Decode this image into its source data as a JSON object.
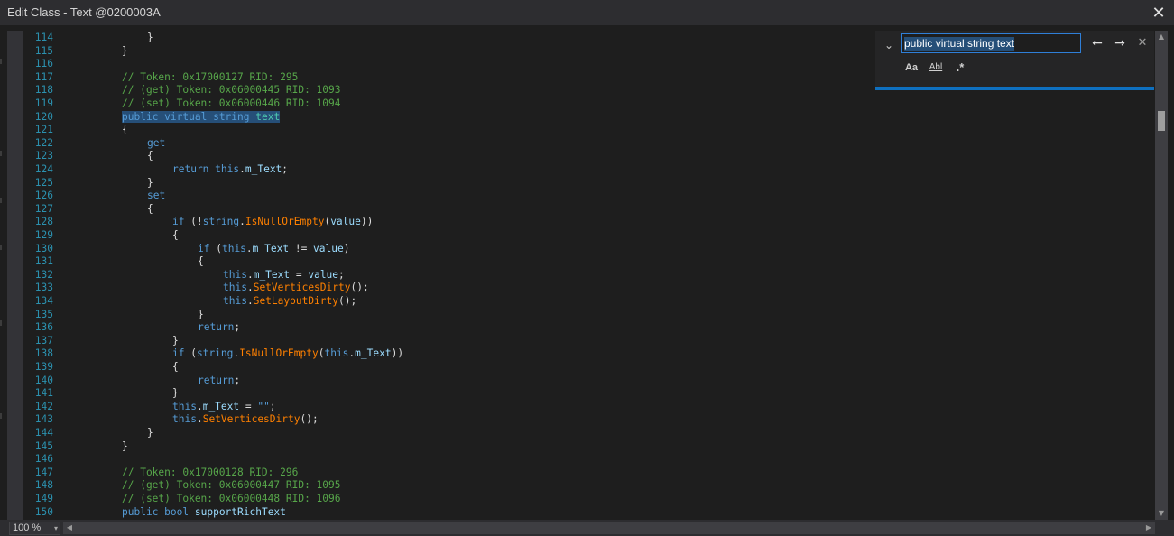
{
  "window": {
    "title": "Edit Class - Text @0200003A",
    "close_glyph": "✕"
  },
  "find": {
    "query": "public virtual string text",
    "chevron_glyph": "⌄",
    "prev_glyph": "←",
    "next_glyph": "→",
    "close_glyph": "✕",
    "options": {
      "match_case": "Aa",
      "whole_word": "Abl",
      "regex": ".*"
    }
  },
  "status": {
    "zoom": "100 %",
    "zoom_caret": "▾"
  },
  "scroll": {
    "up": "▲",
    "down": "▼",
    "left": "◀",
    "right": "▶"
  },
  "code": {
    "lines": [
      {
        "n": "114",
        "t": "    }"
      },
      {
        "n": "115",
        "t": "}"
      },
      {
        "n": "116",
        "t": ""
      },
      {
        "n": "117",
        "t": "// Token: 0x17000127 RID: 295"
      },
      {
        "n": "118",
        "t": "// (get) Token: 0x06000445 RID: 1093"
      },
      {
        "n": "119",
        "t": "// (set) Token: 0x06000446 RID: 1094"
      },
      {
        "n": "120",
        "t": "public virtual string text"
      },
      {
        "n": "121",
        "t": "{"
      },
      {
        "n": "122",
        "t": "    get"
      },
      {
        "n": "123",
        "t": "    {"
      },
      {
        "n": "124",
        "t": "        return this.m_Text;"
      },
      {
        "n": "125",
        "t": "    }"
      },
      {
        "n": "126",
        "t": "    set"
      },
      {
        "n": "127",
        "t": "    {"
      },
      {
        "n": "128",
        "t": "        if (!string.IsNullOrEmpty(value))"
      },
      {
        "n": "129",
        "t": "        {"
      },
      {
        "n": "130",
        "t": "            if (this.m_Text != value)"
      },
      {
        "n": "131",
        "t": "            {"
      },
      {
        "n": "132",
        "t": "                this.m_Text = value;"
      },
      {
        "n": "133",
        "t": "                this.SetVerticesDirty();"
      },
      {
        "n": "134",
        "t": "                this.SetLayoutDirty();"
      },
      {
        "n": "135",
        "t": "            }"
      },
      {
        "n": "136",
        "t": "            return;"
      },
      {
        "n": "137",
        "t": "        }"
      },
      {
        "n": "138",
        "t": "        if (string.IsNullOrEmpty(this.m_Text))"
      },
      {
        "n": "139",
        "t": "        {"
      },
      {
        "n": "140",
        "t": "            return;"
      },
      {
        "n": "141",
        "t": "        }"
      },
      {
        "n": "142",
        "t": "        this.m_Text = \"\";"
      },
      {
        "n": "143",
        "t": "        this.SetVerticesDirty();"
      },
      {
        "n": "144",
        "t": "    }"
      },
      {
        "n": "145",
        "t": "}"
      },
      {
        "n": "146",
        "t": ""
      },
      {
        "n": "147",
        "t": "// Token: 0x17000128 RID: 296"
      },
      {
        "n": "148",
        "t": "// (get) Token: 0x06000447 RID: 1095"
      },
      {
        "n": "149",
        "t": "// (set) Token: 0x06000448 RID: 1096"
      },
      {
        "n": "150",
        "t": "public bool supportRichText"
      }
    ]
  }
}
